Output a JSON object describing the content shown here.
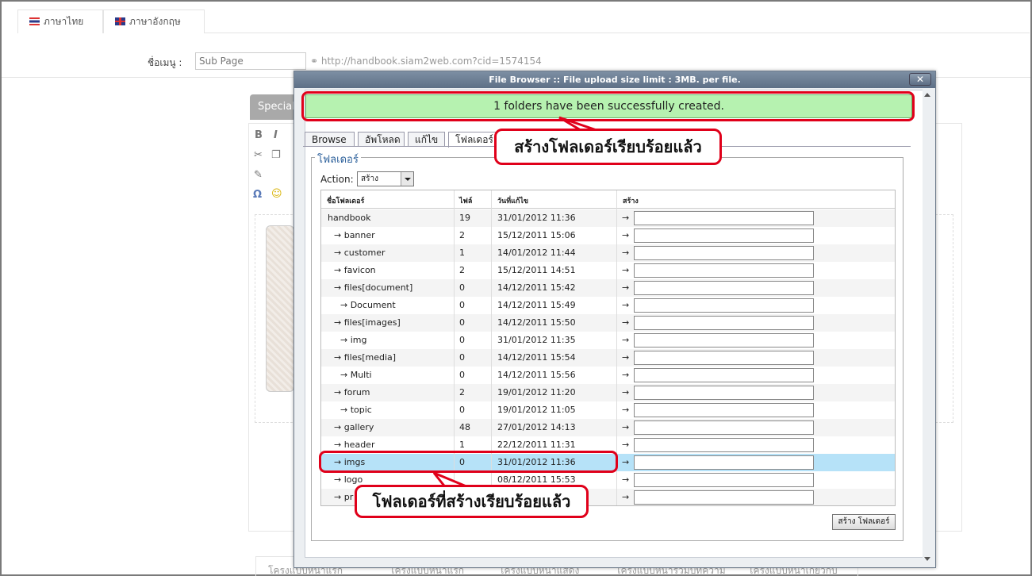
{
  "lang_tabs": [
    "ภาษาไทย",
    "ภาษาอังกฤษ"
  ],
  "menu": {
    "label": "ชื่อเมนู :",
    "input_value": "Sub Page",
    "link": "http://handbook.siam2web.com?cid=1574154"
  },
  "background": {
    "special_tab": "Special",
    "toolbar": [
      "B",
      "I"
    ],
    "bottom_tabs": [
      "โครงแบบหน้าแรก",
      "โครงแบบหน้าแรก",
      "โครงแบบหน้าแสดง",
      "โครงแบบหน้ารวมบทความ",
      "โครงแบบหน้าเกี่ยวกับ"
    ]
  },
  "dialog": {
    "title": "File Browser :: File upload size limit : 3MB. per file.",
    "close": "✕",
    "success_message": "1 folders have been successfully created.",
    "tabs": [
      "Browse",
      "อัพโหลด",
      "แก้ไข",
      "โฟลเดอร์"
    ],
    "legend": "โฟลเดอร์",
    "action_label": "Action:",
    "action_value": "สร้าง",
    "columns": [
      "ชื่อโฟลเดอร์",
      "ไฟล์",
      "วันที่แก้ไข",
      "สร้าง"
    ],
    "rows": [
      {
        "name": "handbook",
        "files": "19",
        "date": "31/01/2012 11:36"
      },
      {
        "name": "→ banner",
        "files": "2",
        "date": "15/12/2011 15:06"
      },
      {
        "name": "→ customer",
        "files": "1",
        "date": "14/01/2012 11:44"
      },
      {
        "name": "→ favicon",
        "files": "2",
        "date": "15/12/2011 14:51"
      },
      {
        "name": "→ files[document]",
        "files": "0",
        "date": "14/12/2011 15:42"
      },
      {
        "name": "→ Document",
        "files": "0",
        "date": "14/12/2011 15:49"
      },
      {
        "name": "→ files[images]",
        "files": "0",
        "date": "14/12/2011 15:50"
      },
      {
        "name": "→ img",
        "files": "0",
        "date": "31/01/2012 11:35"
      },
      {
        "name": "→ files[media]",
        "files": "0",
        "date": "14/12/2011 15:54"
      },
      {
        "name": "→ Multi",
        "files": "0",
        "date": "14/12/2011 15:56"
      },
      {
        "name": "→ forum",
        "files": "2",
        "date": "19/01/2012 11:20"
      },
      {
        "name": "→ topic",
        "files": "0",
        "date": "19/01/2012 11:05"
      },
      {
        "name": "→ gallery",
        "files": "48",
        "date": "27/01/2012 14:13"
      },
      {
        "name": "→ header",
        "files": "1",
        "date": "22/12/2011 11:31"
      },
      {
        "name": "→ imgs",
        "files": "0",
        "date": "31/01/2012 11:36"
      },
      {
        "name": "→ logo",
        "files": "",
        "date": "08/12/2011 15:53"
      },
      {
        "name": "→ pr",
        "files": "",
        "date": ""
      }
    ],
    "arrow": "→",
    "create_button": "สร้าง โฟลเดอร์"
  },
  "annotations": {
    "folder_created": "สร้างโฟลเดอร์เรียบร้อยแล้ว",
    "created_folder": "โฟลเดอร์ที่สร้างเรียบร้อยแล้ว"
  },
  "colors": {
    "success_bg": "#b6f2b0",
    "highlight_row": "#b6e2f8",
    "annotation_red": "#e0001a",
    "dialog_title": "#6a7c92"
  }
}
